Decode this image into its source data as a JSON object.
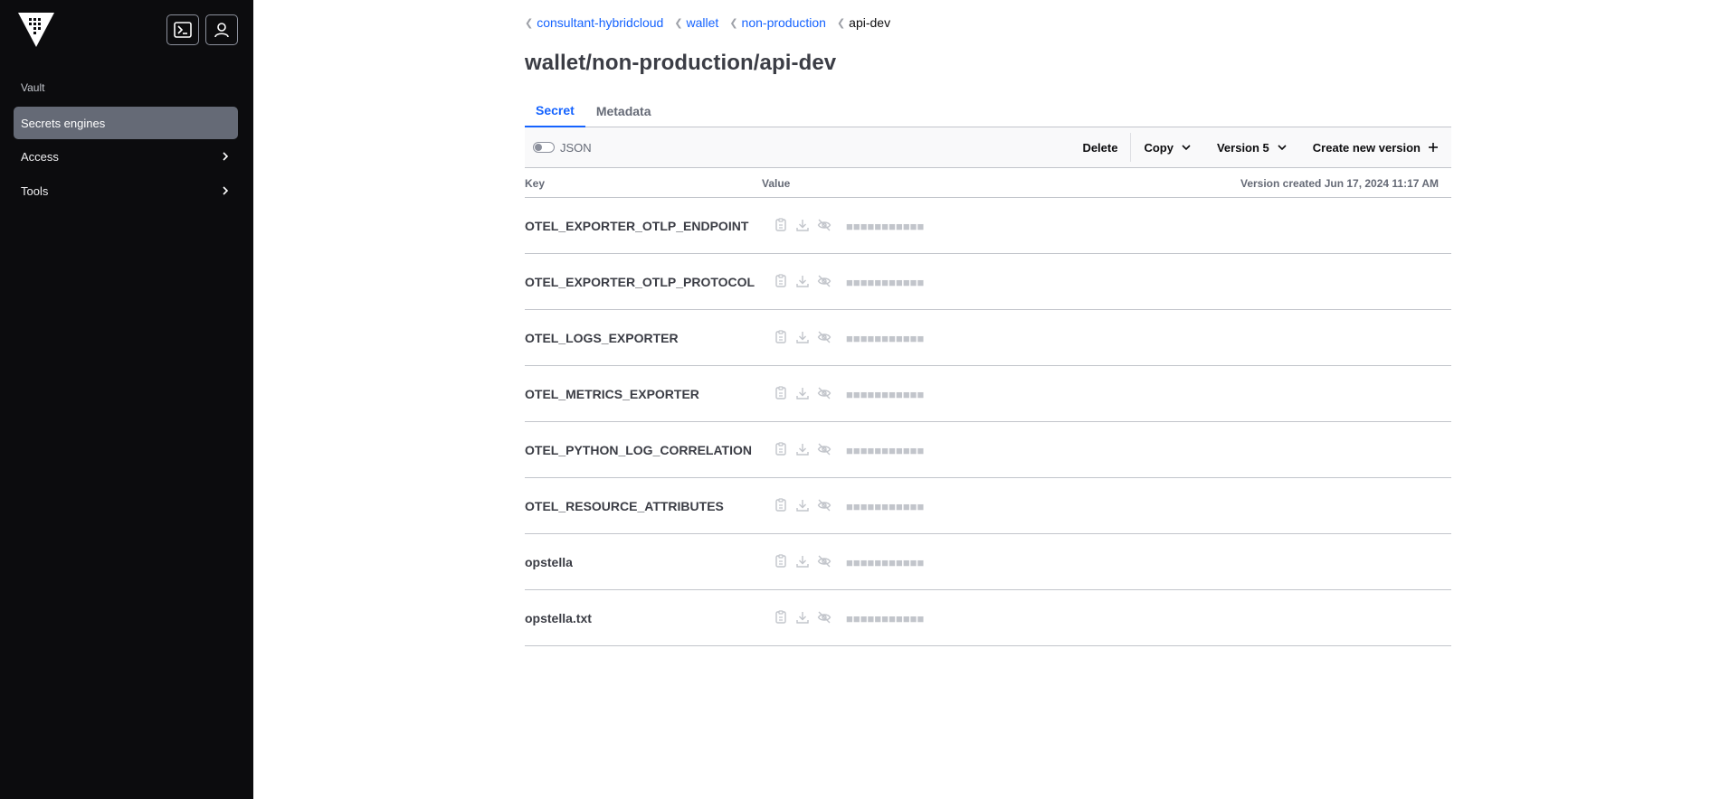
{
  "sidebar": {
    "heading": "Vault",
    "items": [
      {
        "label": "Secrets engines",
        "active": true
      },
      {
        "label": "Access",
        "active": false
      },
      {
        "label": "Tools",
        "active": false
      }
    ],
    "icons": {
      "logo": "vault-logo-icon",
      "console": "terminal-icon",
      "user": "user-icon"
    }
  },
  "breadcrumb": [
    {
      "label": "consultant-hybridcloud"
    },
    {
      "label": "wallet"
    },
    {
      "label": "non-production"
    },
    {
      "label": "api-dev"
    }
  ],
  "page_title": "wallet/non-production/api-dev",
  "tabs": [
    {
      "label": "Secret",
      "active": true
    },
    {
      "label": "Metadata",
      "active": false
    }
  ],
  "toolbar": {
    "json_toggle_label": "JSON",
    "delete_label": "Delete",
    "copy_label": "Copy",
    "version_label": "Version 5",
    "create_label": "Create new version"
  },
  "table": {
    "key_header": "Key",
    "value_header": "Value",
    "version_created": "Version created Jun 17, 2024 11:17 AM",
    "rows": [
      {
        "key": "OTEL_EXPORTER_OTLP_ENDPOINT",
        "masked": "■■■■■■■■■■■"
      },
      {
        "key": "OTEL_EXPORTER_OTLP_PROTOCOL",
        "masked": "■■■■■■■■■■■"
      },
      {
        "key": "OTEL_LOGS_EXPORTER",
        "masked": "■■■■■■■■■■■"
      },
      {
        "key": "OTEL_METRICS_EXPORTER",
        "masked": "■■■■■■■■■■■"
      },
      {
        "key": "OTEL_PYTHON_LOG_CORRELATION",
        "masked": "■■■■■■■■■■■"
      },
      {
        "key": "OTEL_RESOURCE_ATTRIBUTES",
        "masked": "■■■■■■■■■■■"
      },
      {
        "key": "opstella",
        "masked": "■■■■■■■■■■■"
      },
      {
        "key": "opstella.txt",
        "masked": "■■■■■■■■■■■"
      }
    ]
  },
  "colors": {
    "sidebar_bg": "#0c0c0e",
    "accent": "#1563ff",
    "active_nav": "#656a76"
  }
}
